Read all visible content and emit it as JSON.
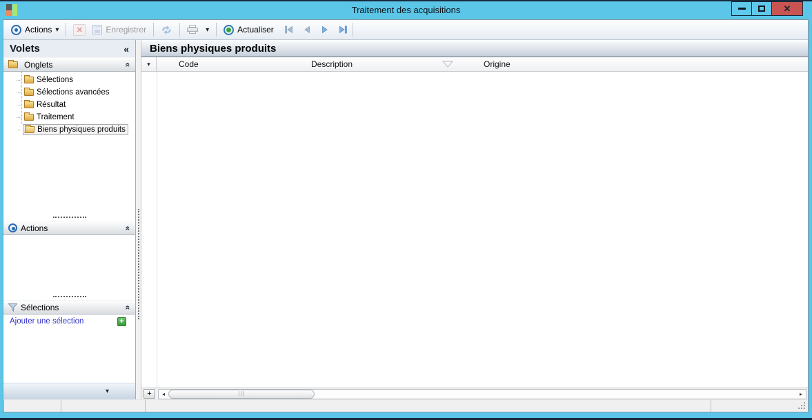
{
  "window": {
    "title": "Traitement des acquisitions"
  },
  "icons": {
    "dropdown_glyph": "▾",
    "collapse_glyph": "«",
    "chevron_up_glyph": "«",
    "close_glyph": "✕",
    "delete_glyph": "✕",
    "plus_glyph": "+",
    "scroll_left_glyph": "◂",
    "scroll_right_glyph": "▸",
    "row_marker_glyph": "▾",
    "panel_chevron_glyph": "▾",
    "thumb_grip_glyph": "|||"
  },
  "toolbar": {
    "actions_label": "Actions",
    "save_label": "Enregistrer",
    "refresh_label": "Actualiser"
  },
  "sidebar": {
    "title": "Volets",
    "sections": {
      "onglets": "Onglets",
      "actions": "Actions",
      "selections": "Sélections"
    },
    "tree": [
      {
        "label": "Sélections"
      },
      {
        "label": "Sélections avancées"
      },
      {
        "label": "Résultat"
      },
      {
        "label": "Traitement"
      },
      {
        "label": "Biens physiques produits"
      }
    ],
    "add_selection_label": "Ajouter une sélection"
  },
  "main": {
    "title": "Biens physiques produits",
    "table": {
      "columns": [
        {
          "label": "Code"
        },
        {
          "label": "Description"
        },
        {
          "label": "Origine"
        }
      ],
      "rows": []
    }
  },
  "colors": {
    "titlebar_cyan": "#5BC6E8",
    "frame_dark": "#182A3C",
    "close_red": "#C85552",
    "accent_blue": "#2A6AB0",
    "actualiser_green": "#3AA63A",
    "link_blue": "#3333CC",
    "folder_gold": "#E3B74A"
  }
}
